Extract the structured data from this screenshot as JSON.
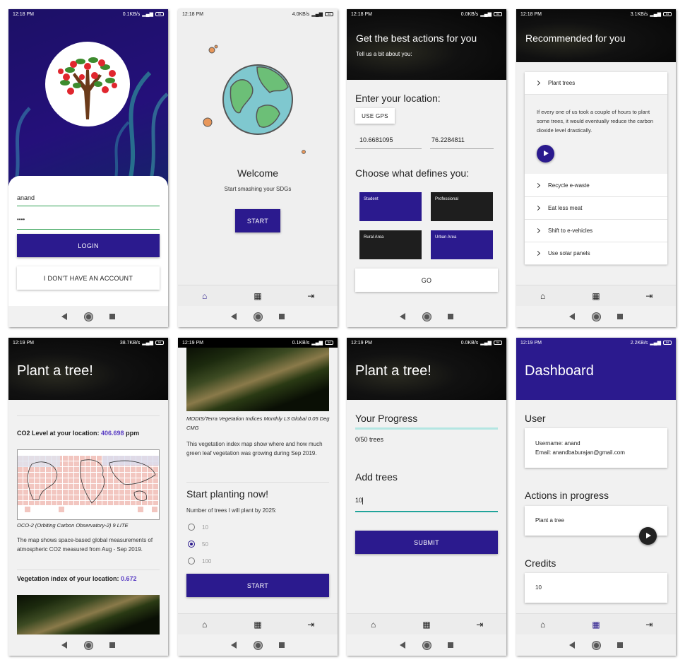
{
  "status_times": [
    "12:18 PM",
    "12:18 PM",
    "12:18 PM",
    "12:18 PM",
    "12:19 PM",
    "12:19 PM",
    "12:19 PM",
    "12:19 PM"
  ],
  "status_speeds": [
    "0.1KB/s",
    "4.0KB/s",
    "0.0KB/s",
    "3.1KB/s",
    "38.7KB/s",
    "0.1KB/s",
    "0.0KB/s",
    "2.2KB/s"
  ],
  "battery": "54",
  "s1": {
    "username": "anand",
    "password": "••••",
    "login": "LOGIN",
    "no_account": "I DON'T HAVE AN ACCOUNT"
  },
  "s2": {
    "welcome": "Welcome",
    "subtitle": "Start smashing your SDGs",
    "start": "START"
  },
  "s3": {
    "title": "Get the best actions for you",
    "subtitle": "Tell us a bit about you:",
    "location_heading": "Enter your location:",
    "use_gps": "USE GPS",
    "lat": "10.6681095",
    "lng": "76.2284811",
    "define_heading": "Choose what defines you:",
    "options": [
      "Student",
      "Professional",
      "Rural Area",
      "Urban Area"
    ],
    "go": "GO"
  },
  "s4": {
    "title": "Recommended for you",
    "items": [
      "Plant trees",
      "Recycle e-waste",
      "Eat less meat",
      "Shift to e-vehicles",
      "Use solar panels"
    ],
    "detail": "If every one of us took a couple of hours to plant some trees, it would eventually reduce the carbon dioxide level drastically."
  },
  "s5": {
    "title": "Plant a tree!",
    "co2_label": "CO2 Level at your location: ",
    "co2_value": "406.698",
    "co2_unit": " ppm",
    "map_caption": "OCO-2 (Orbiting Carbon Observatory-2) 9 LITE",
    "map_desc": "The map shows space-based global measurements of atmospheric CO2 measured from Aug - Sep 2019.",
    "veg_label": "Vegetation index of your location: ",
    "veg_value": "0.672"
  },
  "s6": {
    "caption": "MODIS/Terra Vegetation Indices Monthly L3 Global 0.05 Deg CMG",
    "desc": "This vegetation index map show where and how much green leaf vegetation was growing during Sep 2019.",
    "heading": "Start planting now!",
    "question": "Number of trees I will plant by 2025:",
    "options": [
      "10",
      "50",
      "100"
    ],
    "selected": "50",
    "start": "START"
  },
  "s7": {
    "title": "Plant a tree!",
    "progress_heading": "Your Progress",
    "progress_text": "0/50 trees",
    "progress_fraction": 0,
    "add_heading": "Add trees",
    "input_value": "10",
    "submit": "SUBMIT"
  },
  "s8": {
    "title": "Dashboard",
    "user_heading": "User",
    "username_line": "Username: anand",
    "email_line": "Email: anandbaburajan@gmail.com",
    "actions_heading": "Actions in progress",
    "action": "Plant a tree",
    "credits_heading": "Credits",
    "credits": "10"
  },
  "colors": {
    "brand_purple": "#2b1a8e",
    "dark_card": "#1e1e1e",
    "accent_green": "#2e9e50",
    "teal": "#21a49a"
  }
}
